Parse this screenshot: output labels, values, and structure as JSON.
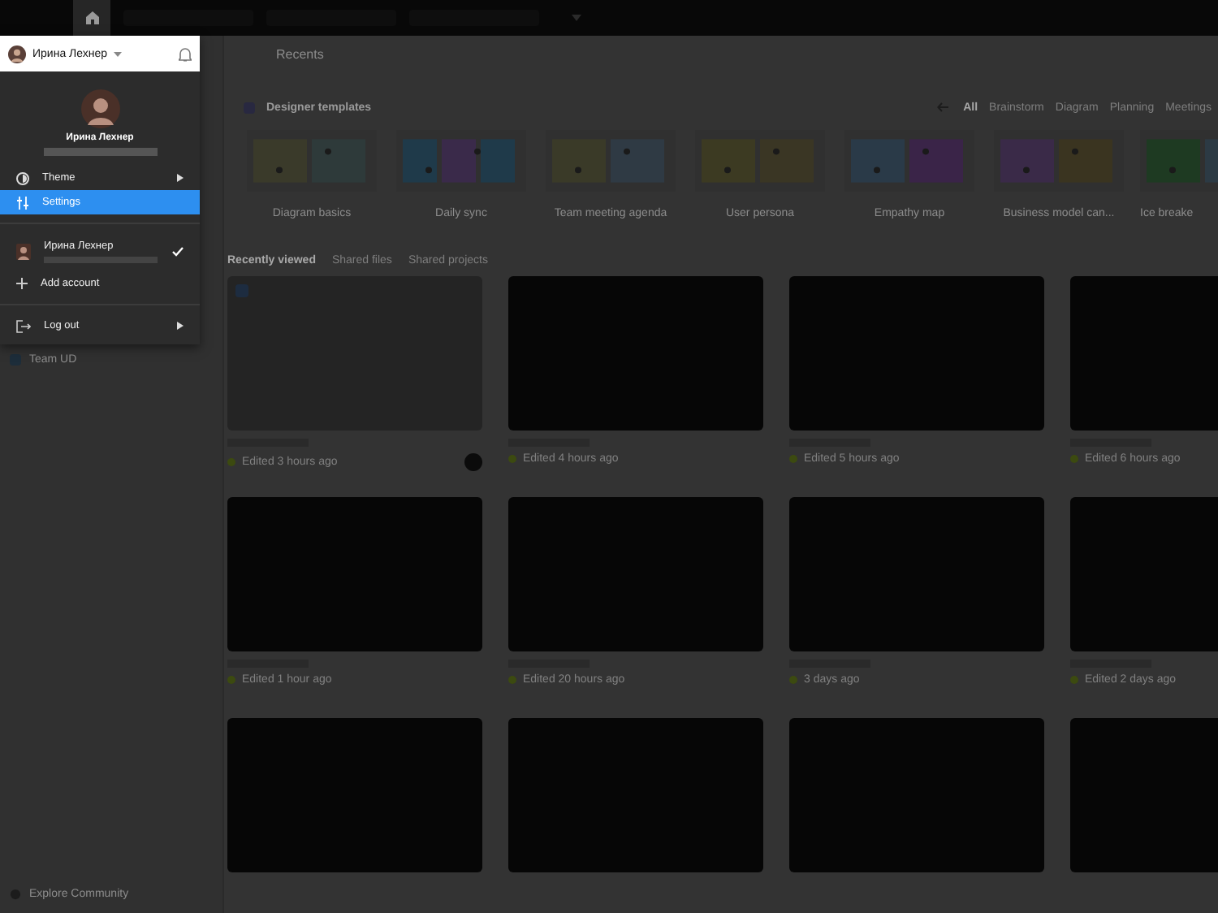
{
  "topbar": {
    "tabs": [
      {
        "kind": "home",
        "selected": true
      },
      {
        "kind": "file",
        "selected": false
      },
      {
        "kind": "file",
        "selected": false
      },
      {
        "kind": "file",
        "selected": false
      }
    ]
  },
  "account_menu": {
    "header_name": "Ирина Лехнер",
    "profile_name": "Ирина Лехнер",
    "items": [
      {
        "kind": "theme",
        "label": "Theme",
        "selected": false,
        "submenu": true
      },
      {
        "kind": "settings",
        "label": "Settings",
        "selected": true,
        "submenu": false
      },
      {
        "kind": "divider"
      },
      {
        "kind": "account",
        "label": "Ирина Лехнер",
        "selected": false,
        "checked": true
      },
      {
        "kind": "add",
        "label": "Add account",
        "selected": false,
        "submenu": false
      },
      {
        "kind": "divider"
      },
      {
        "kind": "logout",
        "label": "Log out",
        "selected": false,
        "submenu": true
      }
    ]
  },
  "sidebar": {
    "items": [
      {
        "label": "Team UD"
      }
    ],
    "footer": "Explore Community"
  },
  "page_title": "Recents",
  "templates": {
    "title": "Designer templates",
    "filters": [
      {
        "label": "All",
        "selected": true
      },
      {
        "label": "Brainstorm",
        "selected": false
      },
      {
        "label": "Diagram",
        "selected": false
      },
      {
        "label": "Planning",
        "selected": false
      },
      {
        "label": "Meetings",
        "selected": false
      }
    ],
    "cards": [
      {
        "name": "Diagram basics",
        "kind": "diagram"
      },
      {
        "name": "Daily sync",
        "kind": "sticky"
      },
      {
        "name": "Team meeting agenda",
        "kind": "agenda"
      },
      {
        "name": "User persona",
        "kind": "persona"
      },
      {
        "name": "Empathy map",
        "kind": "empathy"
      },
      {
        "name": "Business model can...",
        "kind": "canvas"
      },
      {
        "name": "Ice breake",
        "kind": "ice"
      }
    ]
  },
  "file_tabs": [
    {
      "label": "Recently viewed",
      "selected": true
    },
    {
      "label": "Shared files",
      "selected": false
    },
    {
      "label": "Shared projects",
      "selected": false
    }
  ],
  "files": [
    {
      "edited": "Edited 3 hours ago",
      "kind": "figjam"
    },
    {
      "edited": "Edited 4 hours ago",
      "kind": "blank"
    },
    {
      "edited": "Edited 5 hours ago",
      "kind": "blank"
    },
    {
      "edited": "Edited 6 hours ago",
      "kind": "blank"
    },
    {
      "edited": "Edited 1 hour ago",
      "kind": "blank"
    },
    {
      "edited": "Edited 20 hours ago",
      "kind": "blank"
    },
    {
      "edited": "3 days ago",
      "kind": "blank"
    },
    {
      "edited": "Edited 2 days ago",
      "kind": "blank"
    },
    {
      "kind": "blank"
    },
    {
      "kind": "blank"
    },
    {
      "kind": "blank"
    },
    {
      "kind": "blank"
    }
  ]
}
